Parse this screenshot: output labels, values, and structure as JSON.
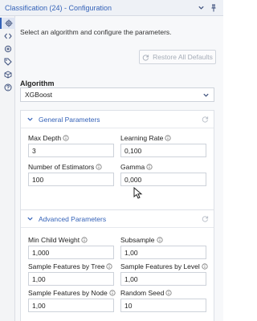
{
  "header": {
    "title": "Classification (24) - Configuration",
    "icons": [
      "chevron-down-icon",
      "pin-icon"
    ]
  },
  "sidebar": {
    "icons": [
      "settings-gear-icon",
      "code-icon",
      "connection-icon",
      "tag-icon",
      "cube-icon",
      "help-icon"
    ],
    "active": 0
  },
  "intro_text": "Select an algorithm and configure the parameters.",
  "restore_button": {
    "label": "Restore All Defaults",
    "enabled": false
  },
  "algorithm": {
    "label": "Algorithm",
    "selected": "XGBoost"
  },
  "general": {
    "title": "General Parameters",
    "fields": {
      "max_depth": {
        "label": "Max Depth",
        "value": "3"
      },
      "learning_rate": {
        "label": "Learning Rate",
        "value": "0,100"
      },
      "n_estimators": {
        "label": "Number of Estimators",
        "value": "100"
      },
      "gamma": {
        "label": "Gamma",
        "value": "0,000"
      }
    }
  },
  "advanced": {
    "title": "Advanced Parameters",
    "fields": {
      "min_child_weight": {
        "label": "Min Child Weight",
        "value": "1,000"
      },
      "subsample": {
        "label": "Subsample",
        "value": "1,00"
      },
      "by_tree": {
        "label": "Sample Features by Tree",
        "value": "1,00"
      },
      "by_level": {
        "label": "Sample Features by Level",
        "value": "1,00"
      },
      "by_node": {
        "label": "Sample Features by Node",
        "value": "1,00"
      },
      "random_seed": {
        "label": "Random Seed",
        "value": "10"
      }
    }
  },
  "colors": {
    "accent": "#3462b8",
    "background": "#f7f8fa"
  }
}
